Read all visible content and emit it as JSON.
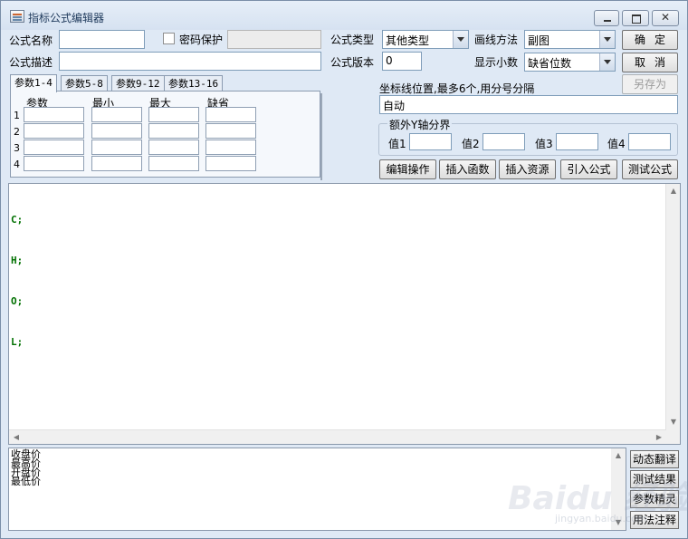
{
  "window": {
    "title": "指标公式编辑器"
  },
  "form": {
    "name_label": "公式名称",
    "name_value": "",
    "password_label": "密码保护",
    "password_checked": false,
    "password_value": "",
    "desc_label": "公式描述",
    "desc_value": "",
    "type_label": "公式类型",
    "type_value": "其他类型",
    "version_label": "公式版本",
    "version_value": "0",
    "draw_label": "画线方法",
    "draw_value": "副图",
    "decimal_label": "显示小数",
    "decimal_value": "缺省位数"
  },
  "buttons": {
    "ok": "确定",
    "cancel": "取消",
    "save_as": "另存为"
  },
  "axis": {
    "label": "坐标线位置,最多6个,用分号分隔",
    "value": "自动"
  },
  "yaxis_group": {
    "title": "额外Y轴分界",
    "labels": [
      "值1",
      "值2",
      "值3",
      "值4"
    ],
    "values": [
      "",
      "",
      "",
      ""
    ]
  },
  "tabs": [
    "参数1-4",
    "参数5-8",
    "参数9-12",
    "参数13-16"
  ],
  "param_headers": [
    "参数",
    "最小",
    "最大",
    "缺省"
  ],
  "param_rows": [
    "1",
    "2",
    "3",
    "4"
  ],
  "actions": [
    "编辑操作",
    "插入函数",
    "插入资源",
    "引入公式",
    "测试公式"
  ],
  "code_lines": [
    "C;",
    "H;",
    "O;",
    "L;"
  ],
  "bottom_list": [
    "收盘价",
    "最高价",
    "开盘价",
    "最低价"
  ],
  "side_buttons": [
    "动态翻译",
    "测试结果",
    "参数精灵",
    "用法注释"
  ],
  "colors": {
    "accent": "#dfe9f5",
    "code_keyword": "#007000"
  }
}
